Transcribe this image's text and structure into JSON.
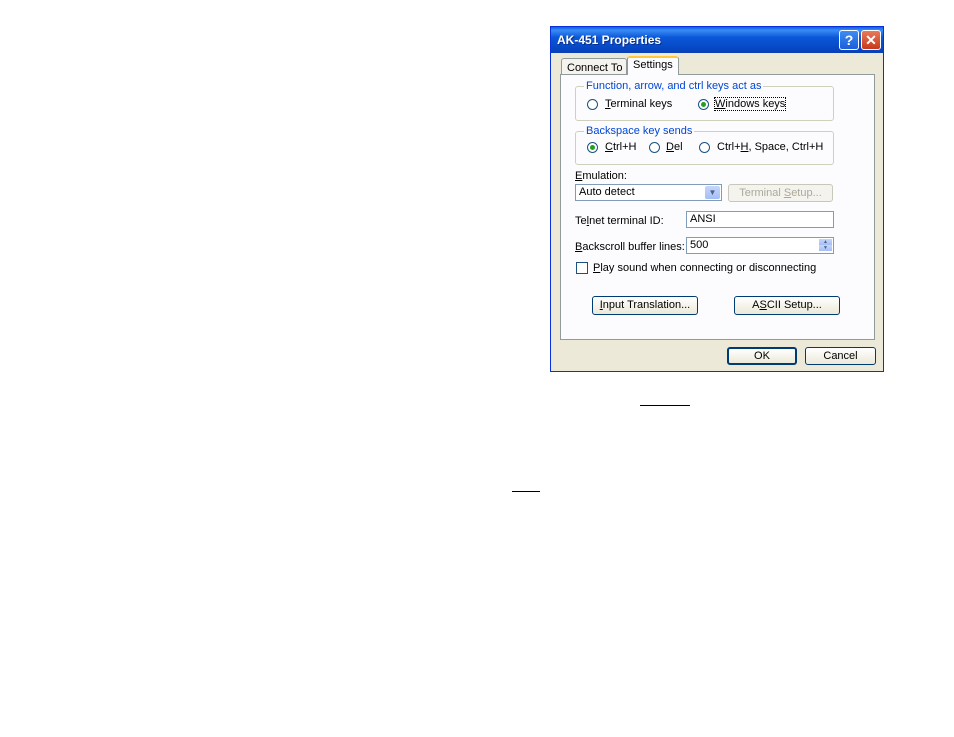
{
  "window": {
    "title": "AK-451 Properties",
    "help_glyph": "?",
    "close_glyph": "✕"
  },
  "tabs": [
    {
      "label": "Connect To"
    },
    {
      "label": "Settings"
    }
  ],
  "function_keys": {
    "legend": "Function, arrow, and ctrl keys act as",
    "options": [
      {
        "label_u": "T",
        "label_rest": "erminal keys"
      },
      {
        "label_u": "W",
        "label_rest": "indows keys"
      }
    ],
    "selected": "Windows keys"
  },
  "backspace": {
    "legend": "Backspace key sends",
    "options": [
      {
        "label_u": "C",
        "label_rest": "trl+H"
      },
      {
        "label_u": "D",
        "label_rest": "el"
      },
      {
        "label_pre": "Ctrl+",
        "label_u": "H",
        "label_rest": ", Space, Ctrl+H"
      }
    ],
    "selected": "Ctrl+H"
  },
  "emulation": {
    "label_u": "E",
    "label_rest": "mulation:",
    "value": "Auto detect",
    "terminal_setup_pre": "Terminal ",
    "terminal_setup_u": "S",
    "terminal_setup_rest": "etup..."
  },
  "telnet_id": {
    "label_pre": "Te",
    "label_u": "l",
    "label_rest": "net terminal ID:",
    "value": "ANSI"
  },
  "backscroll": {
    "label_u": "B",
    "label_rest": "ackscroll buffer lines:",
    "value": "500"
  },
  "play_sound": {
    "label_u": "P",
    "label_rest": "lay sound when connecting or disconnecting",
    "checked": false
  },
  "buttons": {
    "input_translation_u": "I",
    "input_translation_rest": "nput Translation...",
    "ascii_setup_pre": "A",
    "ascii_setup_u": "S",
    "ascii_setup_rest": "CII Setup...",
    "ok": "OK",
    "cancel": "Cancel"
  },
  "colors": {
    "title_blue": "#0a58d8",
    "dialog_bg": "#ece9d8",
    "legend_blue": "#0046d5",
    "radio_green": "#21a121"
  }
}
